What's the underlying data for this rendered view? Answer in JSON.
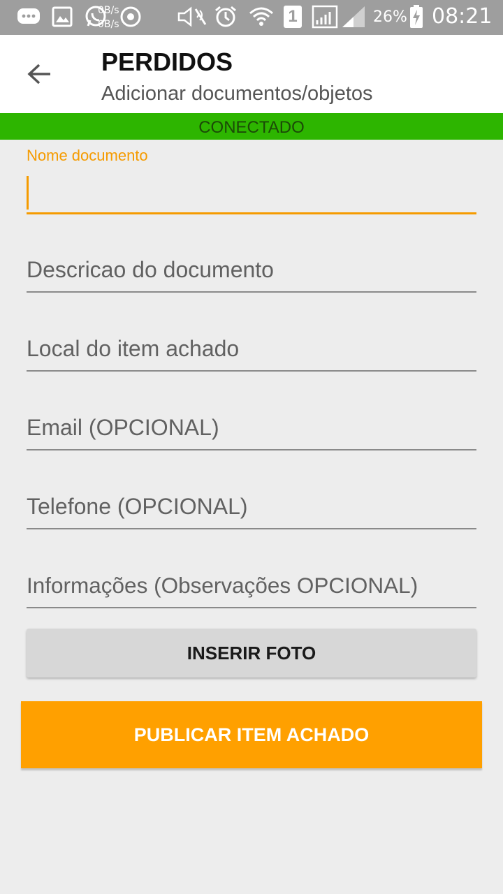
{
  "status_bar": {
    "speed_up": "0B/s",
    "speed_down": "0B/s",
    "sim_slot": "1",
    "battery_percent": "26%",
    "time": "08:21"
  },
  "app_bar": {
    "title": "PERDIDOS",
    "subtitle": "Adicionar documentos/objetos"
  },
  "connection": {
    "status": "CONECTADO",
    "color": "#2db500"
  },
  "form": {
    "active_label": "Nome documento",
    "fields": [
      {
        "placeholder": "",
        "value": ""
      },
      {
        "placeholder": "Descricao do documento"
      },
      {
        "placeholder": "Local do item achado"
      },
      {
        "placeholder": "Email  (OPCIONAL)"
      },
      {
        "placeholder": "Telefone (OPCIONAL)"
      },
      {
        "placeholder": "Informações (Observações OPCIONAL)"
      }
    ]
  },
  "buttons": {
    "photo_label": "INSERIR FOTO",
    "publish_label": "PUBLICAR ITEM ACHADO"
  },
  "colors": {
    "accent": "#ffa000",
    "status_bar": "#9e9e9e"
  }
}
